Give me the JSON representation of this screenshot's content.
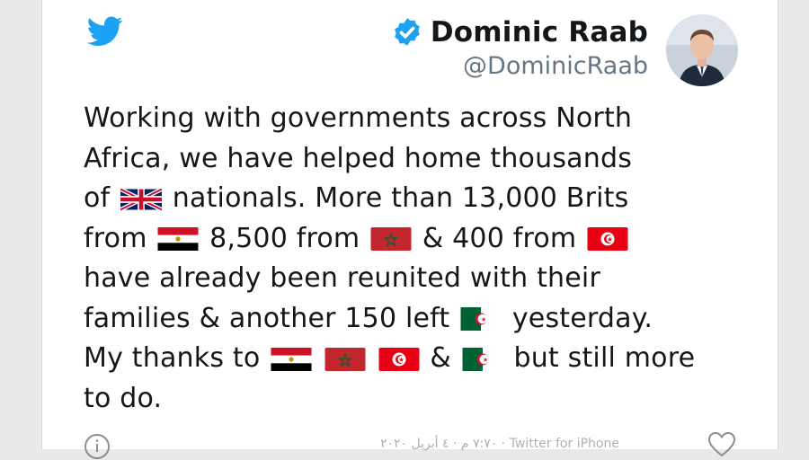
{
  "author": {
    "display_name": "Dominic Raab",
    "handle": "@DominicRaab"
  },
  "tweet": {
    "lines": [
      [
        "Working with governments across North"
      ],
      [
        "Africa, we have helped home thousands"
      ],
      [
        "of ",
        "flag:uk",
        " nationals. More than 13,000 Brits"
      ],
      [
        "from ",
        "flag:egypt",
        " 8,500 from ",
        "flag:morocco",
        " & 400 from ",
        "flag:tunisia"
      ],
      [
        " have already been reunited with their"
      ],
      [
        "families & another 150 left ",
        "flag:algeria",
        " yesterday."
      ],
      [
        "My thanks to ",
        "flag:egypt",
        " ",
        "flag:morocco",
        " ",
        "flag:tunisia",
        " & ",
        "flag:algeria",
        " but still more"
      ],
      [
        "to do."
      ]
    ]
  },
  "footer": {
    "faded_text": "٧:٧٠ م · ٤ أبريل ٢٠٢٠ · Twitter for iPhone"
  },
  "icons": {
    "logo": "twitter-bird-icon",
    "verified": "verified-badge-icon",
    "info": "info-icon",
    "like": "heart-icon"
  },
  "colors": {
    "twitter_blue": "#1da1f2",
    "text": "#14171a",
    "muted": "#657786"
  }
}
